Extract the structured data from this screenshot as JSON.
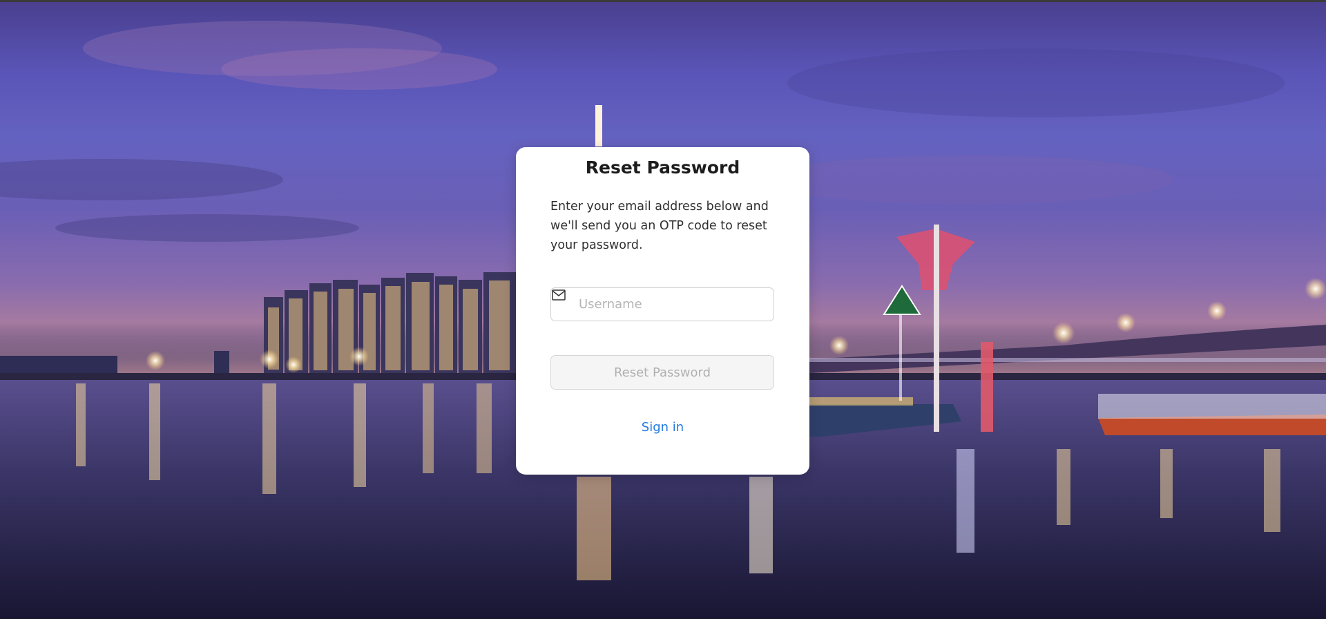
{
  "reset_form": {
    "title": "Reset Password",
    "description": "Enter your email address below and we'll send you an OTP code to reset your password.",
    "username_input": {
      "value": "",
      "placeholder": "Username",
      "icon": "mail-icon"
    },
    "submit_button": {
      "label": "Reset Password",
      "state": "disabled"
    },
    "sign_in_link": "Sign in"
  },
  "colors": {
    "link": "#1f7ae0",
    "card_background": "#ffffff",
    "disabled_button_background": "#f5f5f5",
    "disabled_button_text": "#b0b0b0"
  }
}
